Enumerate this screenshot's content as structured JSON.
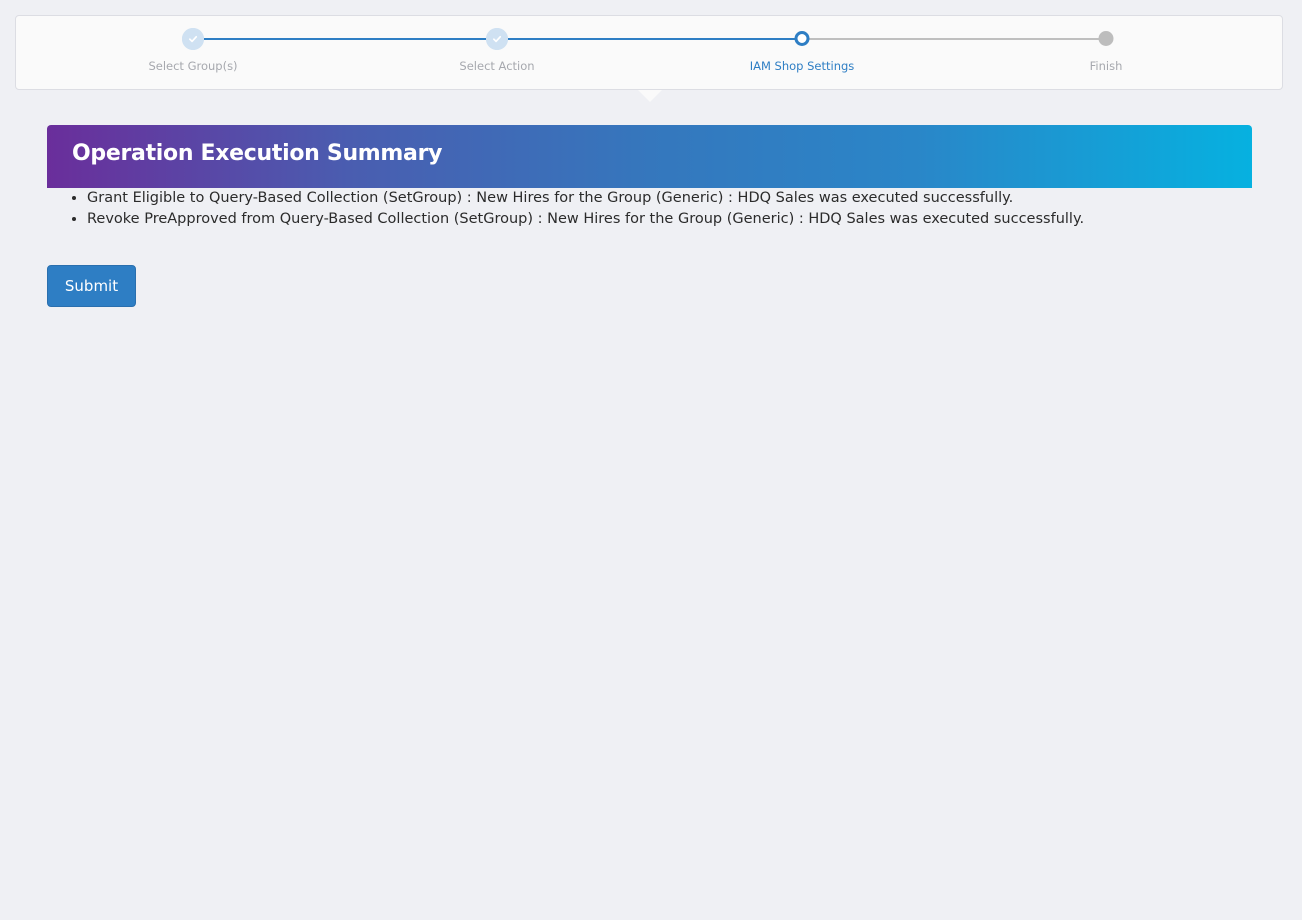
{
  "wizard": {
    "steps": [
      {
        "label": "Select Group(s)",
        "state": "completed"
      },
      {
        "label": "Select Action",
        "state": "completed"
      },
      {
        "label": "IAM Shop Settings",
        "state": "current"
      },
      {
        "label": "Finish",
        "state": "pending"
      }
    ]
  },
  "summary": {
    "title": "Operation Execution Summary",
    "messages": [
      "Grant Eligible to Query-Based Collection (SetGroup) : New Hires for the Group (Generic) : HDQ Sales was executed successfully.",
      "Revoke PreApproved from Query-Based Collection (SetGroup) : New Hires for the Group (Generic) : HDQ Sales was executed successfully."
    ]
  },
  "actions": {
    "submit_label": "Submit"
  },
  "colors": {
    "accent": "#2e7ec4",
    "header_gradient_start": "#6a2e9b",
    "header_gradient_end": "#06b1e0",
    "pending": "#bdbdbd"
  },
  "icons": {
    "completed_step": "check-icon"
  }
}
